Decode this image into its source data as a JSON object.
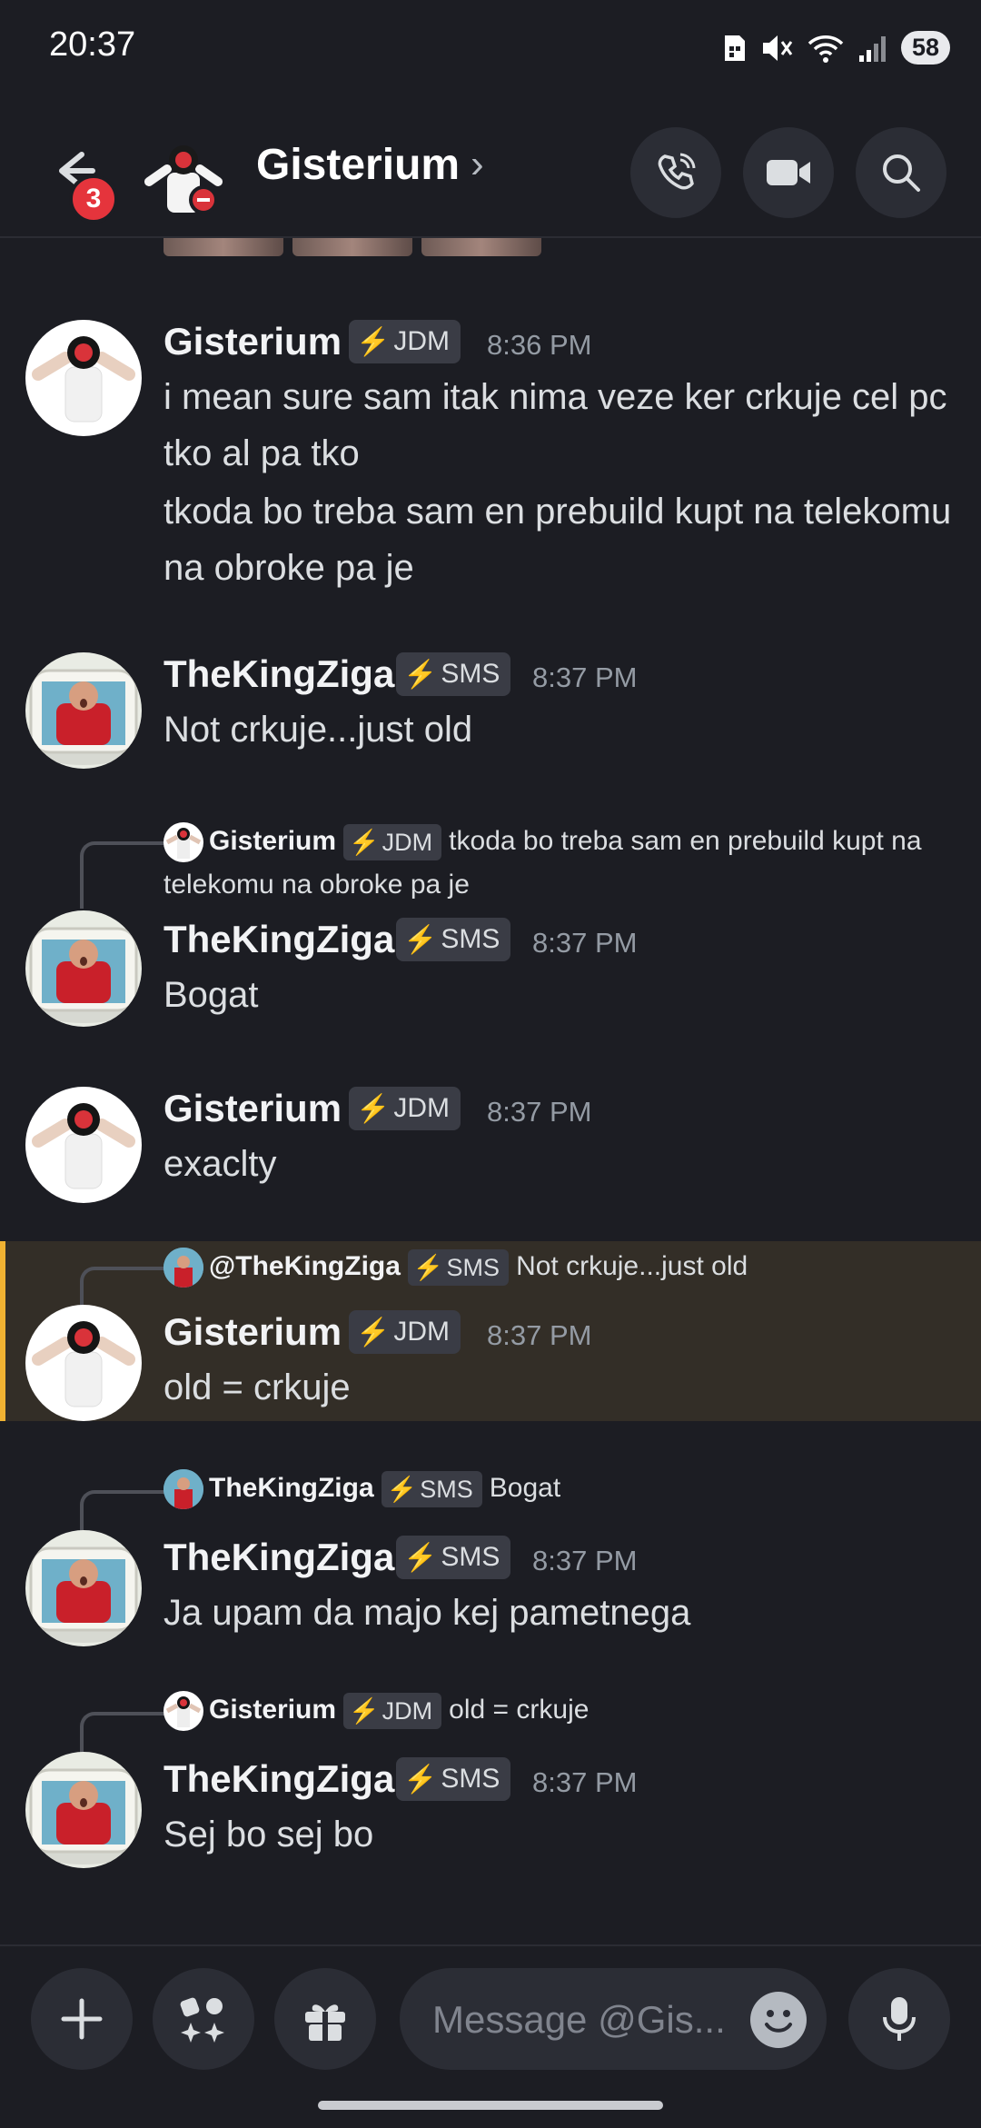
{
  "status_bar": {
    "time": "20:37",
    "battery": "58"
  },
  "header": {
    "back_badge": "3",
    "title": "Gisterium"
  },
  "messages": [
    {
      "name": "Gisterium",
      "tag": "JDM",
      "time": "8:36 PM",
      "lines": [
        "i mean sure sam itak nima veze ker crkuje cel pc tko al pa tko",
        "tkoda bo treba sam en prebuild kupt na telekomu na obroke pa je"
      ]
    },
    {
      "name": "TheKingZiga",
      "tag": "SMS",
      "time": "8:37 PM",
      "text": "Not crkuje...just old"
    },
    {
      "reply": {
        "name": "Gisterium",
        "tag": "JDM",
        "text": "tkoda bo treba sam en prebuild kupt na telekomu na obroke pa je"
      },
      "name": "TheKingZiga",
      "tag": "SMS",
      "time": "8:37 PM",
      "text": "Bogat"
    },
    {
      "name": "Gisterium",
      "tag": "JDM",
      "time": "8:37 PM",
      "text": "exaclty"
    },
    {
      "reply": {
        "name": "@TheKingZiga",
        "tag": "SMS",
        "text": "Not crkuje...just old"
      },
      "name": "Gisterium",
      "tag": "JDM",
      "time": "8:37 PM",
      "text": "old = crkuje"
    },
    {
      "reply": {
        "name": "TheKingZiga",
        "tag": "SMS",
        "text": "Bogat"
      },
      "name": "TheKingZiga",
      "tag": "SMS",
      "time": "8:37 PM",
      "text": "Ja upam da majo kej pametnega"
    },
    {
      "reply": {
        "name": "Gisterium",
        "tag": "JDM",
        "text": "old = crkuje"
      },
      "name": "TheKingZiga",
      "tag": "SMS",
      "time": "8:37 PM",
      "text": "Sej bo sej bo"
    }
  ],
  "composer": {
    "placeholder": "Message @Gis..."
  },
  "colors": {
    "jdm_bolt": "#ff73fa",
    "sms_bolt": "#57f287",
    "highlight_bar": "#f0b232",
    "badge": "#e5343c"
  }
}
